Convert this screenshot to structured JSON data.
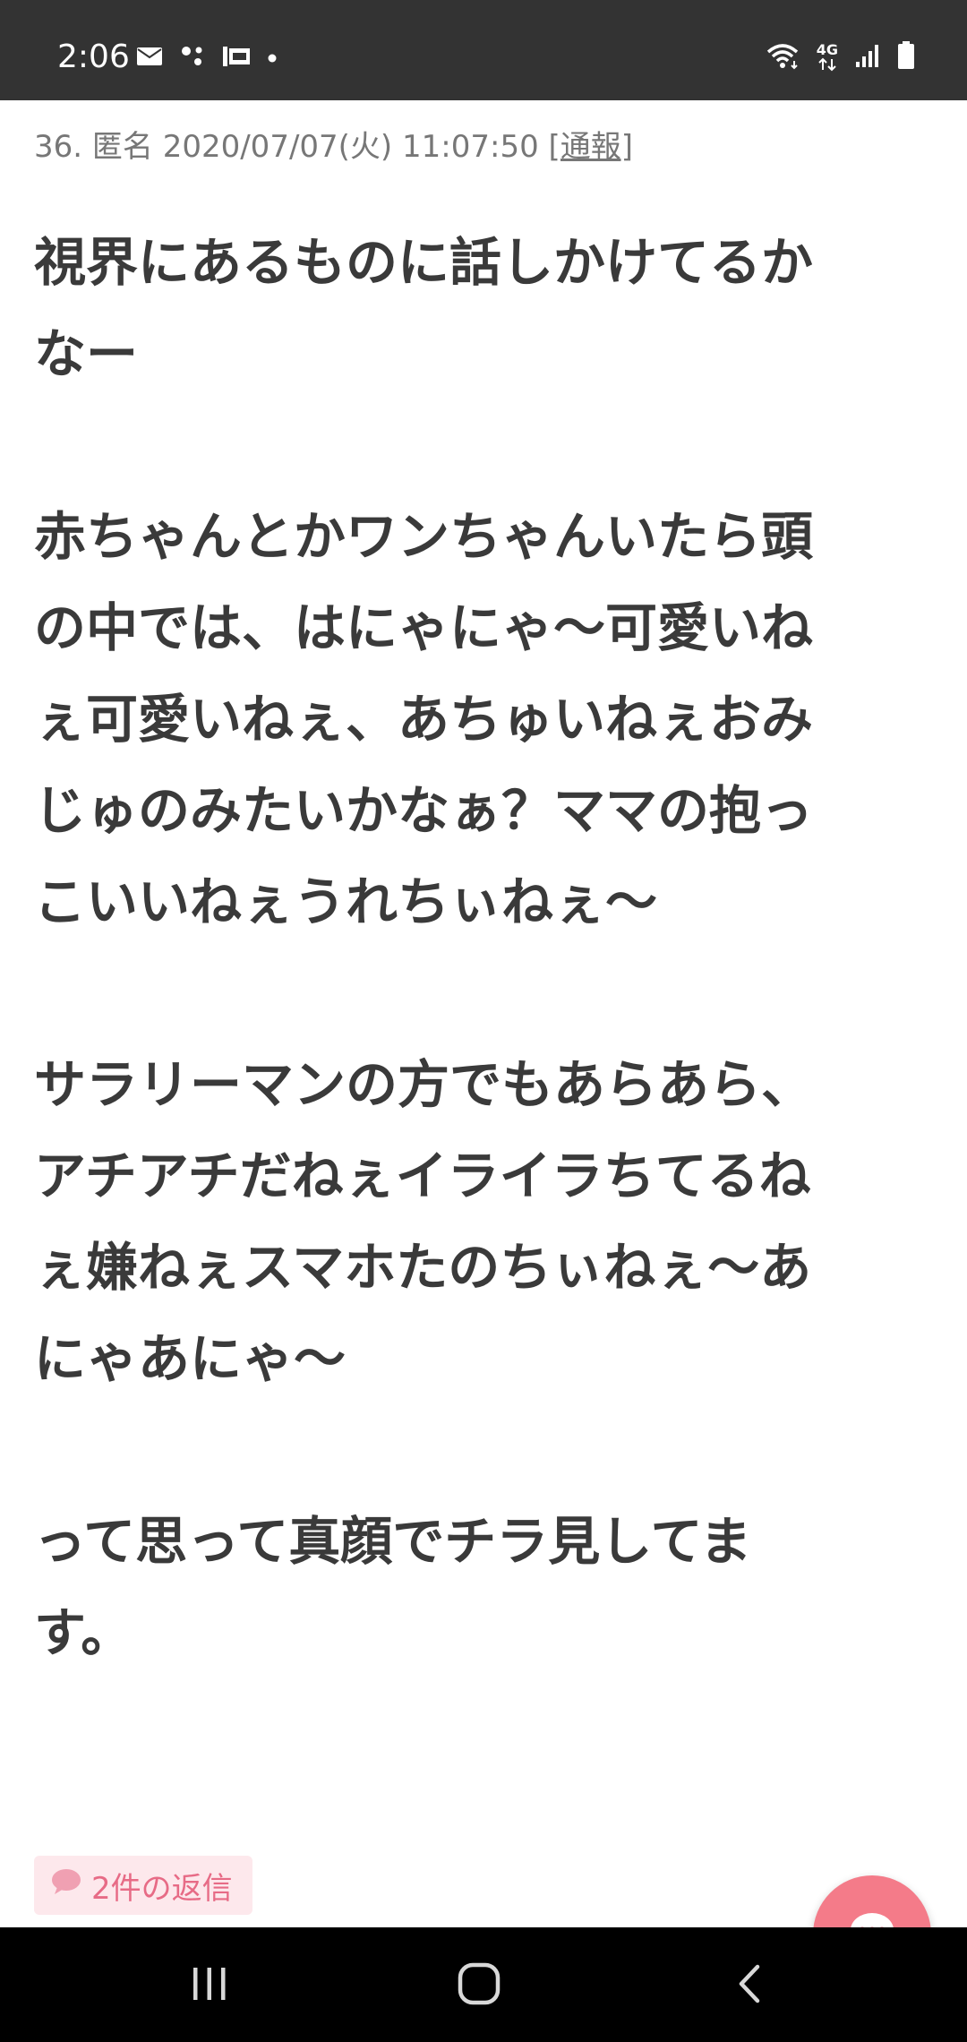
{
  "status_bar": {
    "time": "2:06",
    "left_icons": [
      "mail-icon",
      "assistant-icon",
      "au-icon",
      "dot-icon"
    ],
    "right_icons": [
      "wifi-icon",
      "4g-icon",
      "signal-icon",
      "battery-icon"
    ],
    "network_label": "4G"
  },
  "post": {
    "meta": {
      "number": "36.",
      "author": "匿名",
      "datetime": "2020/07/07(火) 11:07:50",
      "report_label": "[通報]"
    },
    "paragraphs": [
      "視界にあるものに話しかけてるか\nなー",
      "赤ちゃんとかワンちゃんいたら頭\nの中では、はにゃにゃ〜可愛いね\nぇ可愛いねぇ、あちゅいねぇおみ\nじゅのみたいかなぁ？ママの抱っ\nこいいねぇうれちぃねぇ〜",
      "サラリーマンの方でもあらあら、\nアチアチだねぇイライラちてるね\nぇ嫌ねぇスマホたのちぃねぇ〜あ\nにゃあにゃ〜",
      "って思って真顔でチラ見してま\nす。"
    ],
    "reply_badge": "2件の返信"
  },
  "colors": {
    "status_bar_bg": "#333333",
    "accent_pink": "#f47b89",
    "badge_bg": "#fde8ec",
    "badge_text": "#e76b86",
    "nav_bar_bg": "#000000"
  },
  "nav_bar": {
    "buttons": [
      "recents-icon",
      "home-icon",
      "back-icon"
    ]
  }
}
